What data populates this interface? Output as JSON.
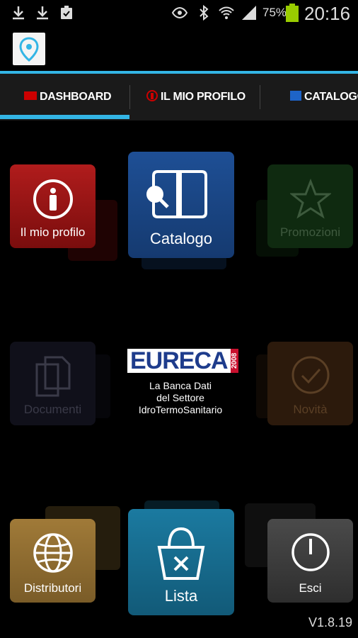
{
  "status_bar": {
    "battery_percent": "75%",
    "time": "20:16",
    "icons": [
      "download-icon",
      "download-icon",
      "clipboard-check-icon",
      "eye-icon",
      "bluetooth-icon",
      "wifi-icon",
      "signal-icon",
      "battery-icon"
    ]
  },
  "tabs": [
    {
      "label": "DASHBOARD",
      "selected": true
    },
    {
      "label": "IL MIO PROFILO",
      "selected": false
    },
    {
      "label": "CATALOGO",
      "selected": false
    }
  ],
  "tiles": {
    "profile": {
      "label": "Il mio profilo",
      "color": "#a01818"
    },
    "catalog": {
      "label": "Catalogo",
      "color": "#1c4a8a"
    },
    "promo": {
      "label": "Promozioni",
      "color": "#1b3a1b"
    },
    "documents": {
      "label": "Documenti",
      "color": "#1a1a2a"
    },
    "news": {
      "label": "Novità",
      "color": "#3b2410"
    },
    "distributors": {
      "label": "Distributori",
      "color": "#8a6a30"
    },
    "list": {
      "label": "Lista",
      "color": "#1a6f8f"
    },
    "exit": {
      "label": "Esci",
      "color": "#3a3a3a"
    }
  },
  "center": {
    "brand": "EURECA",
    "year": "2008",
    "tagline_1": "La Banca Dati",
    "tagline_2": "del Settore",
    "tagline_3": "IdroTermoSanitario"
  },
  "version": "V1.8.19"
}
